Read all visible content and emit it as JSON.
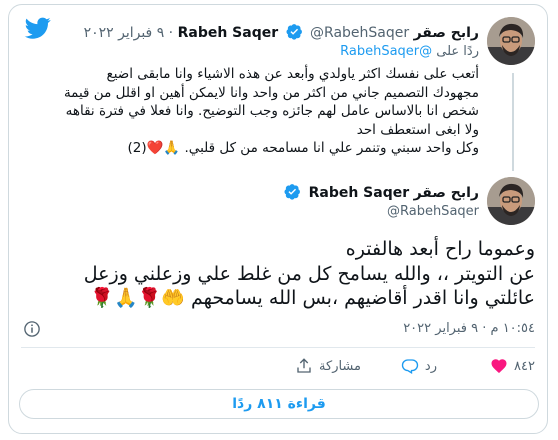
{
  "quoted": {
    "name": "رابح صقر",
    "name_latin": "Rabeh Saqer",
    "handle": "@RabehSaqer",
    "date": "· ٩ فبراير ٢٠٢٢",
    "reply_prefix": "ردًا على",
    "reply_handle": "@RabehSaqer",
    "lines": [
      "أتعب على نفسك اكثر ياولدي  وأبعد عن هذه الاشياء وانا مابقى اضيع",
      "مجهودك التصميم جاني من اكثر من واحد وانا لايمكن أهين او اقلل من قيمة",
      "شخص انا بالاساس عامل لهم جائزه وجب التوضيح. وانا فعلا في فترة نقاهه",
      "ولا ابغى استعطف احد",
      "وكل واحد سبني وتنمر علي انا مسامحه من كل قلبي. 🙏❤️(2)"
    ]
  },
  "main": {
    "name": "رابح صقر",
    "name_latin": "Rabeh Saqer",
    "handle": "@RabehSaqer",
    "lines": [
      "وعموما راح أبعد هالفتره",
      "عن التويتر ،، والله يسامح كل من غلط علي وزعلني وزعل",
      "عائلتي وانا اقدر أقاضيهم ،بس الله يسامحهم 🤲🌹🙏🌹"
    ],
    "timestamp": "١٠:٥٤ م · ٩ فبراير ٢٠٢٢"
  },
  "actions": {
    "likes": "٨٤٢",
    "reply": "رد",
    "share": "مشاركة"
  },
  "read_replies": "قراءة ٨١١ ردًا",
  "colors": {
    "accent": "#1d9bf0",
    "like": "#f91880",
    "muted": "#536471"
  },
  "icons": [
    "twitter-bird-icon",
    "verified-badge-icon",
    "info-icon",
    "heart-icon",
    "reply-icon",
    "share-icon"
  ]
}
